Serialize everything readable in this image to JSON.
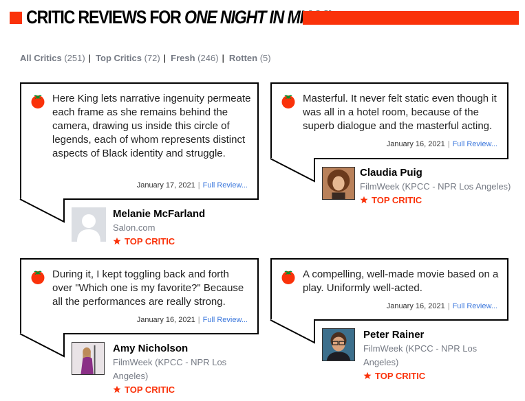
{
  "colors": {
    "accent": "#fa320a",
    "link": "#3976dc",
    "muted": "#757a84"
  },
  "header": {
    "title_prefix": "CRITIC REVIEWS FOR ",
    "title_movie": "ONE NIGHT IN MIAMI"
  },
  "filters": [
    {
      "label": "All Critics",
      "count": "(251)"
    },
    {
      "label": "Top Critics",
      "count": "(72)"
    },
    {
      "label": "Fresh",
      "count": "(246)"
    },
    {
      "label": "Rotten",
      "count": "(5)"
    }
  ],
  "reviews": [
    {
      "quote": "Here King lets narrative ingenuity permeate each frame as she remains behind the camera, drawing us inside this circle of legends, each of whom represents distinct aspects of Black identity and struggle.",
      "date": "January 17, 2021",
      "link": "Full Review...",
      "critic": "Melanie McFarland",
      "publication": "Salon.com",
      "badge": "TOP CRITIC",
      "avatar": "placeholder-avatar"
    },
    {
      "quote": "Masterful. It never felt static even though it was all in a hotel room, because of the superb dialogue and the masterful acting.",
      "date": "January 16, 2021",
      "link": "Full Review...",
      "critic": "Claudia Puig",
      "publication": "FilmWeek (KPCC - NPR Los Angeles)",
      "badge": "TOP CRITIC",
      "avatar": "photo-woman-curly-hair"
    },
    {
      "quote": "During it, I kept toggling back and forth over \"Which one is my favorite?\" Because all the performances are really strong.",
      "date": "January 16, 2021",
      "link": "Full Review...",
      "critic": "Amy Nicholson",
      "publication": "FilmWeek (KPCC - NPR Los Angeles)",
      "badge": "TOP CRITIC",
      "avatar": "photo-woman-purple"
    },
    {
      "quote": "A compelling, well-made movie based on a play. Uniformly well-acted.",
      "date": "January 16, 2021",
      "link": "Full Review...",
      "critic": "Peter Rainer",
      "publication": "FilmWeek (KPCC - NPR Los Angeles)",
      "badge": "TOP CRITIC",
      "avatar": "photo-man-glasses"
    }
  ]
}
